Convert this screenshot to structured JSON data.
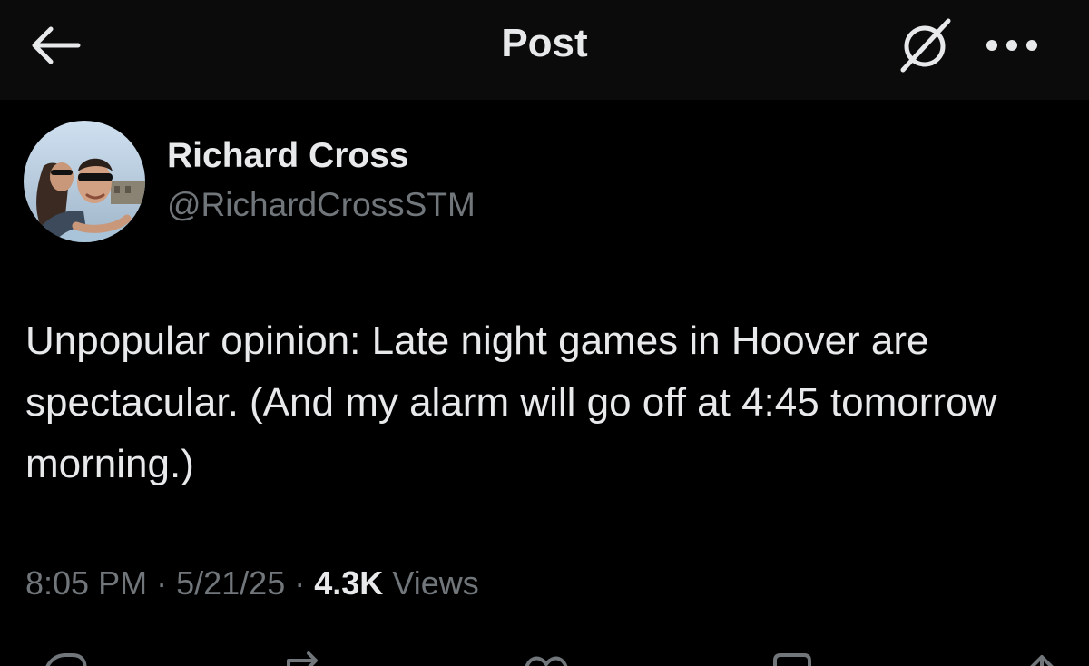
{
  "header": {
    "title": "Post",
    "back_icon": "arrow-left-icon",
    "grok_icon": "grok-icon",
    "more_icon": "more-horizontal-icon"
  },
  "author": {
    "name": "Richard Cross",
    "handle": "@RichardCrossSTM"
  },
  "post": {
    "text": "Unpopular opinion: Late night games in Hoover are spectacular. (And my alarm will go off at 4:45 tomorrow morning.)",
    "time": "8:05 PM",
    "date": "5/21/25",
    "separator": "·",
    "views_count": "4.3K",
    "views_label": "Views"
  },
  "actions": [
    "reply-icon",
    "repost-icon",
    "like-icon",
    "bookmark-icon",
    "share-icon"
  ],
  "colors": {
    "background": "#000000",
    "header_background": "#0b0b0b",
    "primary_text": "#e7e9ea",
    "secondary_text": "#71767b"
  }
}
